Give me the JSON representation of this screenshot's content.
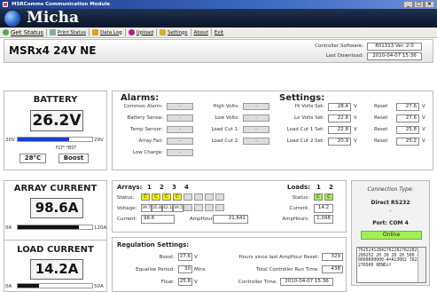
{
  "window": {
    "title": "MSRComms Communication Module",
    "minimize": "_",
    "maximize": "□",
    "close": "×"
  },
  "header": {
    "title": "Micha"
  },
  "toolbar": {
    "items": [
      "Get Status",
      "Print Status",
      "Data Log",
      "Upload",
      "Settings",
      "About",
      "Exit"
    ]
  },
  "banner": {
    "unit_name": "MSRx4 24V NE",
    "controller_software_label": "Controller Software:",
    "controller_software_value": "801313  Ver. 2.0",
    "last_download_label": "Last Download:",
    "last_download_value": "2010-04-07  15:36"
  },
  "battery": {
    "title": "BATTERY",
    "voltage": "26.2V",
    "bar_min": "20V",
    "bar_max": "29V",
    "bar_fraction": 0.69,
    "flags": "FLT*     *BST",
    "temp": "28°C",
    "mode": "Boost"
  },
  "alarms": {
    "title": "Alarms:",
    "left": [
      {
        "label": "Common Alarm:",
        "value": "-"
      },
      {
        "label": "Battery Sense:",
        "value": "-"
      },
      {
        "label": "Temp Sensor:",
        "value": "-"
      },
      {
        "label": "Array Fail:",
        "value": "-"
      },
      {
        "label": "Low Charge:",
        "value": "-"
      }
    ],
    "right": [
      {
        "label": "High Volts:",
        "value": "-"
      },
      {
        "label": "Low Volts:",
        "value": "-"
      },
      {
        "label": "Load Cut 1:",
        "value": "-"
      },
      {
        "label": "Load Cut 2:",
        "value": "-"
      }
    ]
  },
  "settings": {
    "title": "Settings:",
    "rows": [
      {
        "label": "Hi Volts Set:",
        "value": "28.4",
        "unit": "V",
        "reset_label": "Reset",
        "reset_value": "27.6",
        "reset_unit": "V"
      },
      {
        "label": "Lo Volts Set:",
        "value": "22.8",
        "unit": "V",
        "reset_label": "Reset",
        "reset_value": "27.6",
        "reset_unit": "V"
      },
      {
        "label": "Load Cut 1 Set:",
        "value": "22.8",
        "unit": "V",
        "reset_label": "Reset",
        "reset_value": "25.8",
        "reset_unit": "V"
      },
      {
        "label": "Load Cut 2 Set:",
        "value": "20.9",
        "unit": "V",
        "reset_label": "Reset",
        "reset_value": "25.2",
        "reset_unit": "V"
      }
    ]
  },
  "array_current": {
    "title": "ARRAY CURRENT",
    "value": "98.6A",
    "bar_min": "0A",
    "bar_max": "120A",
    "bar_fraction": 0.82
  },
  "arrays": {
    "title": "Arrays:",
    "numbers": [
      "1",
      "2",
      "3",
      "4"
    ],
    "status_label": "Status:",
    "status": [
      "C",
      "C",
      "C",
      "C"
    ],
    "voltage_label": "Voltage:",
    "voltages": [
      "39.7",
      "35.8",
      "42.1",
      "39.5"
    ],
    "current_label": "Current:",
    "current": "98.6",
    "amphours_label": "AmpHours:",
    "amphours": "21,641"
  },
  "loads": {
    "title": "Loads:",
    "numbers": [
      "1",
      "2"
    ],
    "status_label": "Status:",
    "status": [
      "C",
      "C"
    ],
    "current_label": "Current:",
    "current": "14.2",
    "amphours_label": "AmpHours:",
    "amphours": "1,098"
  },
  "connection": {
    "title": "Connection Type:",
    "type": "Direct RS232",
    "dash": "-",
    "port": "Port: COM 4",
    "status": "Online",
    "log": "7625241284276228276228258209252 20 30 20 20 500 450000000000-4=A13002 76234276500 0ENDif"
  },
  "load_current": {
    "title": "LOAD CURRENT",
    "value": "14.2A",
    "bar_min": "0A",
    "bar_max": "50A",
    "bar_fraction": 0.28
  },
  "regulation": {
    "title": "Regulation Settings:",
    "boost_label": "Boost:",
    "boost_value": "27.6",
    "boost_unit": "V",
    "equalise_label": "Equalise Period:",
    "equalise_value": "30",
    "equalise_unit": "Mins",
    "float_label": "Float:",
    "float_value": "25.8",
    "float_unit": "V",
    "hours_reset_label": "Hours since last AmpHour Reset:",
    "hours_reset_value": "329",
    "total_run_label": "Total Controller Run Time:",
    "total_run_value": "438",
    "controller_time_label": "Controller Time:",
    "controller_time_value": "2010-04-07  15:36"
  }
}
